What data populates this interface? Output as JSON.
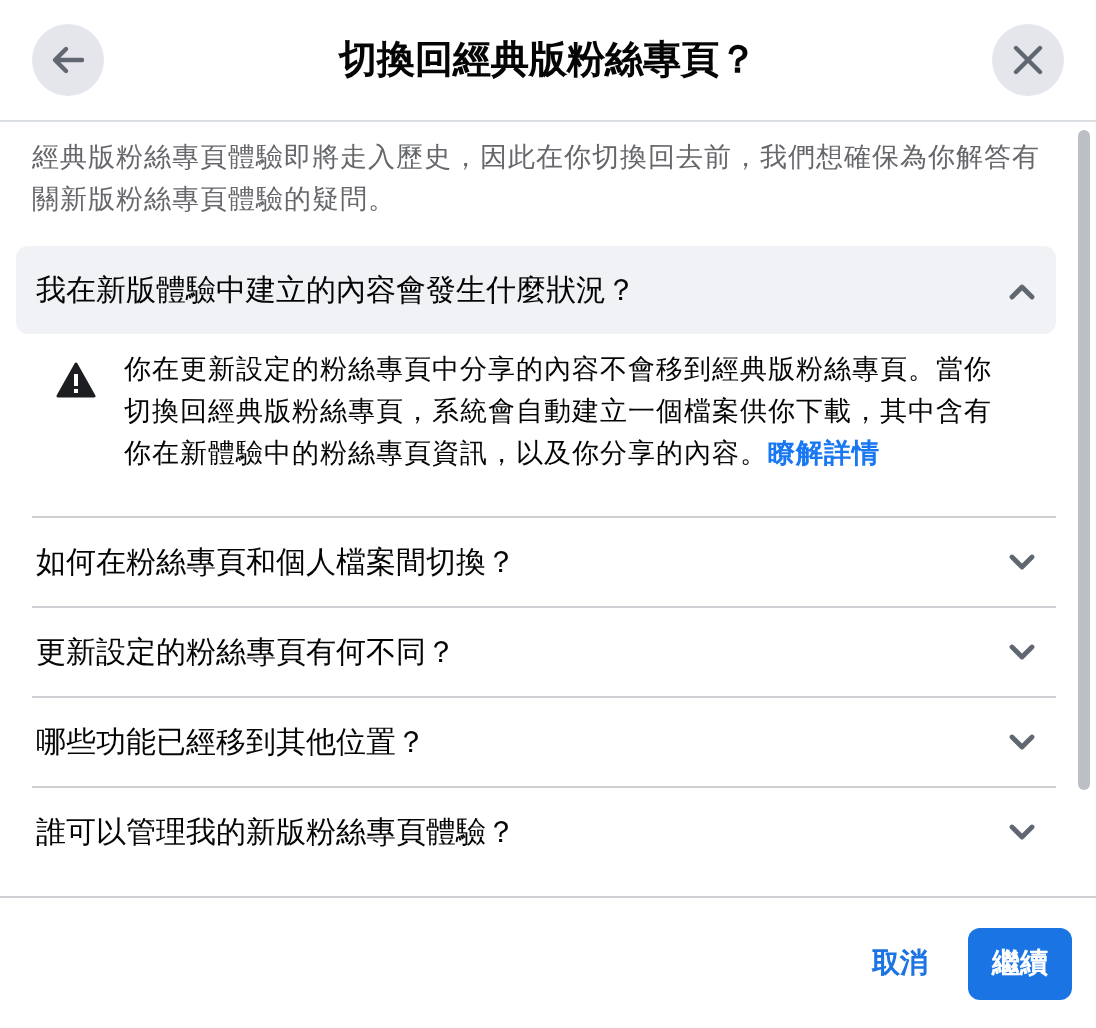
{
  "dialog": {
    "title": "切換回經典版粉絲專頁？",
    "intro": "經典版粉絲專頁體驗即將走入歷史，因此在你切換回去前，我們想確保為你解答有關新版粉絲專頁體驗的疑問。",
    "faq": [
      {
        "question": "我在新版體驗中建立的內容會發生什麼狀況？",
        "expanded": true,
        "answer": "你在更新設定的粉絲專頁中分享的內容不會移到經典版粉絲專頁。當你切換回經典版粉絲專頁，系統會自動建立一個檔案供你下載，其中含有你在新體驗中的粉絲專頁資訊，以及你分享的內容。",
        "link": "瞭解詳情"
      },
      {
        "question": "如何在粉絲專頁和個人檔案間切換？",
        "expanded": false
      },
      {
        "question": "更新設定的粉絲專頁有何不同？",
        "expanded": false
      },
      {
        "question": "哪些功能已經移到其他位置？",
        "expanded": false
      },
      {
        "question": "誰可以管理我的新版粉絲專頁體驗？",
        "expanded": false
      }
    ],
    "buttons": [
      {
        "label": "取消",
        "kind": "secondary"
      },
      {
        "label": "繼續",
        "kind": "primary"
      }
    ]
  }
}
